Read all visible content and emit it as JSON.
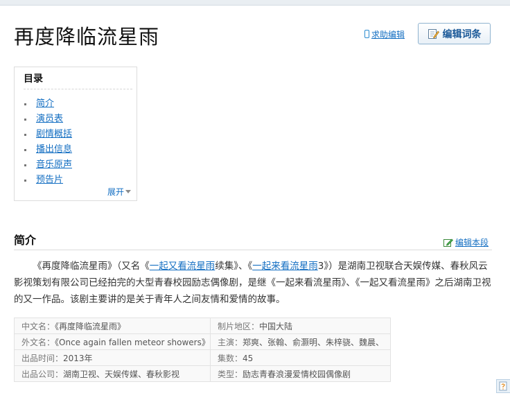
{
  "page": {
    "title": "再度降临流星雨",
    "help_edit": "求助编辑",
    "edit_entry": "编辑词条"
  },
  "toc": {
    "title": "目录",
    "items": [
      "简介",
      "演员表",
      "剧情概括",
      "播出信息",
      "音乐原声",
      "预告片"
    ],
    "expand": "展开"
  },
  "section": {
    "title": "简介",
    "edit": "编辑本段"
  },
  "intro": {
    "t1": "《再度降临流星雨》（又名《",
    "link1": "一起又看流星雨",
    "t2": "续集》、《",
    "link2": "一起来看流星雨",
    "t3": "3》）是湖南卫视联合天娱传媒、春秋风云影视策划有限公司已经拍完的大型青春校园励志偶像剧，是继《一起来看流星雨》、《一起又看流星雨》之后湖南卫视的又一作品。该剧主要讲的是关于青年人之间友情和爱情的故事。"
  },
  "infobox": [
    [
      {
        "label": "中文名：",
        "value": "《再度降临流星雨》"
      },
      {
        "label": "制片地区：",
        "value": "中国大陆"
      }
    ],
    [
      {
        "label": "外文名：",
        "value": "《Once again fallen meteor showers》"
      },
      {
        "label": "主演：",
        "value": "郑爽、张翰、俞灏明、朱梓骁、魏晨、"
      }
    ],
    [
      {
        "label": "出品时间：",
        "value": "2013年"
      },
      {
        "label": "集数：",
        "value": "45"
      }
    ],
    [
      {
        "label": "出品公司：",
        "value": "湖南卫视、天娱传媒、春秋影视"
      },
      {
        "label": "类型：",
        "value": "励志青春浪漫爱情校园偶像剧"
      }
    ]
  ],
  "icons": {
    "help": "pencil-icon",
    "edit_entry": "edit-document-icon",
    "edit_section": "edit-icon",
    "feedback": "feedback-icon"
  },
  "colors": {
    "link": "#136ec2",
    "button_text": "#1c5a99"
  }
}
